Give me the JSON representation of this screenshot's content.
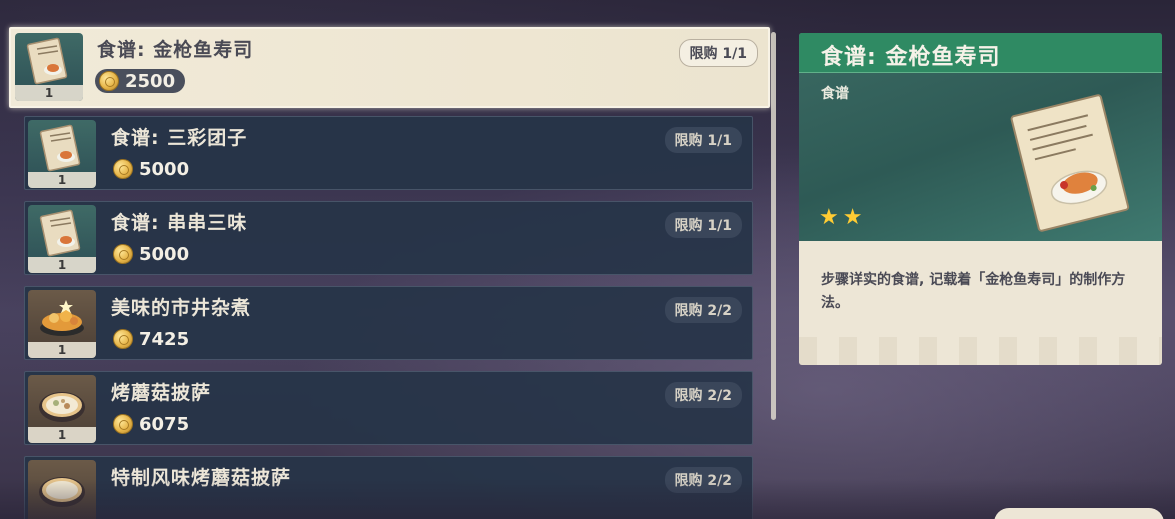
{
  "shop_items": [
    {
      "name": "食谱: 金枪鱼寿司",
      "price": "2500",
      "limit": "限购 1/1",
      "qty": "1",
      "icon": "recipe-scroll-icon",
      "selected": true
    },
    {
      "name": "食谱: 三彩团子",
      "price": "5000",
      "limit": "限购 1/1",
      "qty": "1",
      "icon": "recipe-scroll-icon"
    },
    {
      "name": "食谱: 串串三味",
      "price": "5000",
      "limit": "限购 1/1",
      "qty": "1",
      "icon": "recipe-scroll-icon"
    },
    {
      "name": "美味的市井杂煮",
      "price": "7425",
      "limit": "限购 2/2",
      "qty": "1",
      "icon": "stew-pot-icon"
    },
    {
      "name": "烤蘑菇披萨",
      "price": "6075",
      "limit": "限购 2/2",
      "qty": "1",
      "icon": "pizza-icon"
    },
    {
      "name": "特制风味烤蘑菇披萨",
      "price": "",
      "limit": "限购 2/2",
      "qty": "",
      "icon": "pizza-icon"
    }
  ],
  "detail": {
    "title": "食谱: 金枪鱼寿司",
    "type": "食谱",
    "rarity_stars": 2,
    "star_glyph": "★",
    "description": "步骤详实的食谱, 记载着「金枪鱼寿司」的制作方法。",
    "icon": "recipe-scroll-icon"
  },
  "colors": {
    "title_bar": "#2f8a63",
    "star": "#ffcc33",
    "selected_bg": "#f1ead8"
  }
}
